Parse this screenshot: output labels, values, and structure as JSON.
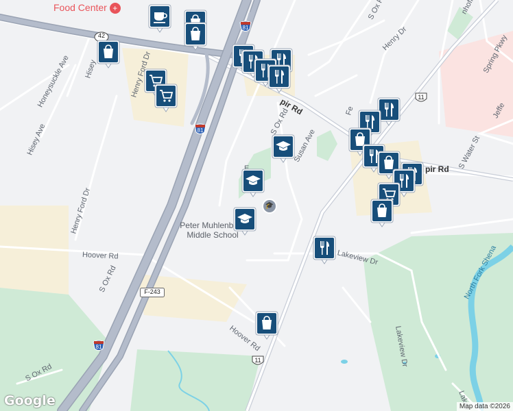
{
  "map": {
    "attribution": "Map data ©2026",
    "logo": "Google",
    "colors": {
      "background": "#f1f2f4",
      "highway": "#b4bccb",
      "highway_edge": "#9aa3b3",
      "road": "#ffffff",
      "park": "#cfead6",
      "commercial": "#f7f0da",
      "medical": "#fbe4e2",
      "water": "#7cd1e6",
      "pin_fill": "#174e7a",
      "school_pin": "#174e7a"
    },
    "road_labels": [
      {
        "text": "S Ox Rd",
        "name": "label-s-ox-rd-top"
      },
      {
        "text": "Henry Dr",
        "name": "label-henry-dr-top"
      },
      {
        "text": "Honeysuckle Ave",
        "name": "label-honeysuckle-ave"
      },
      {
        "text": "Hisey Ave",
        "name": "label-hisey-ave"
      },
      {
        "text": "Hisey",
        "name": "label-hisey"
      },
      {
        "text": "Henry Ford Dr",
        "name": "label-henry-ford-dr-top"
      },
      {
        "text": "Henry Ford Dr",
        "name": "label-henry-ford-dr"
      },
      {
        "text": "S Ox Rd",
        "name": "label-s-ox-rd-mid"
      },
      {
        "text": "Susan Ave",
        "name": "label-susan-ave"
      },
      {
        "text": "Hoover Rd",
        "name": "label-hoover-rd-left"
      },
      {
        "text": "S Ox Rd",
        "name": "label-s-ox-rd-lower"
      },
      {
        "text": "Hoover Rd",
        "name": "label-hoover-rd-bottom"
      },
      {
        "text": "S Ox Rd",
        "name": "label-s-ox-rd-bottom"
      },
      {
        "text": "Lakeview Dr",
        "name": "label-lakeview-dr"
      },
      {
        "text": "Lakeview Dr",
        "name": "label-lakeview-dr-vertical"
      },
      {
        "text": "Lakev",
        "name": "label-lakeview-bottom"
      },
      {
        "text": "S Water St",
        "name": "label-s-water-st"
      },
      {
        "text": "Spring Pkwy",
        "name": "label-spring-pkwy"
      },
      {
        "text": "Jeffe",
        "name": "label-jefferson"
      },
      {
        "text": "Fe",
        "name": "label-fe"
      },
      {
        "text": "nhoff Dr",
        "name": "label-hoff-dr"
      },
      {
        "text": "pir Rd",
        "name": "label-pir-rd-upper"
      },
      {
        "text": "pir Rd",
        "name": "label-pir-rd-right"
      },
      {
        "text": "E",
        "name": "label-e"
      },
      {
        "text": "North Fork Shena",
        "name": "label-north-fork"
      }
    ],
    "shields": [
      {
        "text": "42",
        "name": "route-42-shield"
      },
      {
        "text": "81",
        "name": "interstate-81-shield-top"
      },
      {
        "text": "81",
        "name": "interstate-81-shield-mid"
      },
      {
        "text": "11",
        "name": "route-11-shield-top"
      },
      {
        "text": "F-243",
        "name": "route-f243-shield"
      },
      {
        "text": "81",
        "name": "interstate-81-shield-bottom"
      },
      {
        "text": "11",
        "name": "route-11-shield-bottom"
      }
    ],
    "places": {
      "food_center": "Food  Center",
      "school_name_1": "Peter Muhlenberg",
      "school_name_2": "Middle School"
    },
    "pins": [
      {
        "type": "coffee",
        "name": "coffee-pin"
      },
      {
        "type": "shopping",
        "name": "shopping-pin-1"
      },
      {
        "type": "shopping",
        "name": "shopping-pin-2"
      },
      {
        "type": "shopping",
        "name": "shopping-pin-3"
      },
      {
        "type": "restaurant",
        "name": "restaurant-pin-1"
      },
      {
        "type": "restaurant",
        "name": "restaurant-pin-2"
      },
      {
        "type": "restaurant",
        "name": "restaurant-pin-3"
      },
      {
        "type": "restaurant",
        "name": "restaurant-pin-4"
      },
      {
        "type": "restaurant",
        "name": "restaurant-pin-5"
      },
      {
        "type": "grocery",
        "name": "grocery-pin-1"
      },
      {
        "type": "grocery",
        "name": "grocery-pin-2"
      },
      {
        "type": "school",
        "name": "school-pin-1"
      },
      {
        "type": "school",
        "name": "school-pin-2"
      },
      {
        "type": "school",
        "name": "school-pin-3"
      },
      {
        "type": "restaurant",
        "name": "restaurant-pin-6"
      },
      {
        "type": "restaurant",
        "name": "restaurant-pin-7"
      },
      {
        "type": "shopping",
        "name": "shopping-pin-4"
      },
      {
        "type": "restaurant",
        "name": "restaurant-pin-8"
      },
      {
        "type": "shopping",
        "name": "shopping-pin-5"
      },
      {
        "type": "restaurant",
        "name": "restaurant-pin-9"
      },
      {
        "type": "restaurant",
        "name": "restaurant-pin-10"
      },
      {
        "type": "grocery",
        "name": "grocery-pin-3"
      },
      {
        "type": "shopping",
        "name": "shopping-pin-6"
      },
      {
        "type": "restaurant",
        "name": "restaurant-pin-11"
      },
      {
        "type": "shopping",
        "name": "shopping-pin-7"
      }
    ]
  }
}
